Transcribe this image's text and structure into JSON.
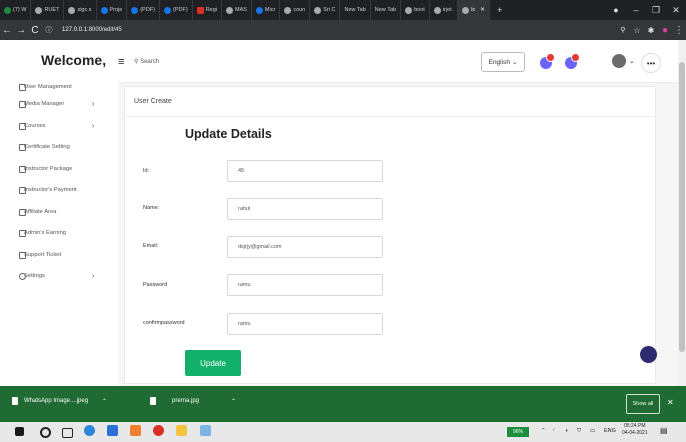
{
  "browser": {
    "tabs": [
      {
        "label": "(7) W",
        "icon": "whatsapp-icon"
      },
      {
        "label": "RUET",
        "icon": "github-icon"
      },
      {
        "label": "sigc.s",
        "icon": "chrome-icon"
      },
      {
        "label": "Proje",
        "icon": "doc-icon"
      },
      {
        "label": "(PDF)",
        "icon": "pdf-icon"
      },
      {
        "label": "(PDF)",
        "icon": "pdf-icon"
      },
      {
        "label": "Regi",
        "icon": "gmail-icon"
      },
      {
        "label": "MAS",
        "icon": "github-icon"
      },
      {
        "label": "Micr",
        "icon": "doc-icon"
      },
      {
        "label": "coun",
        "icon": "chrome-icon"
      },
      {
        "label": "Sri C",
        "icon": "github-icon"
      },
      {
        "label": "New Tab",
        "icon": "none"
      },
      {
        "label": "New Tab",
        "icon": "none"
      },
      {
        "label": "boot",
        "icon": "chrome-icon"
      },
      {
        "label": "irjet.",
        "icon": "chrome-icon"
      },
      {
        "label": "lc",
        "icon": "chrome-icon",
        "active": true
      }
    ],
    "url_prefix": "127.0.0.1",
    "url_rest": ":8000/edit/45"
  },
  "topbar": {
    "welcome": "Welcome,",
    "search": "Search",
    "language": "English"
  },
  "sidebar": {
    "items": [
      {
        "label": "User Management",
        "chevron": true
      },
      {
        "label": "Media Manager",
        "chevron": true
      },
      {
        "label": "Courses",
        "chevron": true
      },
      {
        "label": "Certificate Setting",
        "chevron": false
      },
      {
        "label": "Instructor Package",
        "chevron": false
      },
      {
        "label": "Instructor's Payment",
        "chevron": false
      },
      {
        "label": "Affiliate Area",
        "chevron": false
      },
      {
        "label": "Admin's Earning",
        "chevron": false
      },
      {
        "label": "Support Ticket",
        "chevron": false
      },
      {
        "label": "Settings",
        "chevron": true
      }
    ]
  },
  "content": {
    "breadcrumb": "User Create",
    "heading": "Update Details",
    "fields": [
      {
        "label": "Id:",
        "value": "45"
      },
      {
        "label": "Name:",
        "value": "rahul"
      },
      {
        "label": "Email:",
        "value": "dsjrjy@gmail.com"
      },
      {
        "label": "Password",
        "value": "ramu"
      },
      {
        "label": "confirmpassword",
        "value": "ramu"
      }
    ],
    "update_button": "Update"
  },
  "downloads": {
    "items": [
      "WhatsApp Image....jpeg",
      "prerna.jpg"
    ],
    "show_all": "Show all"
  },
  "taskbar": {
    "battery": "96%",
    "lang": "ENG",
    "time": "05:24 PM",
    "date": "04-04-2021"
  },
  "colors": {
    "accent_green": "#12b06b",
    "shelf_green": "#1f6b33",
    "browser_dark": "#202124"
  }
}
